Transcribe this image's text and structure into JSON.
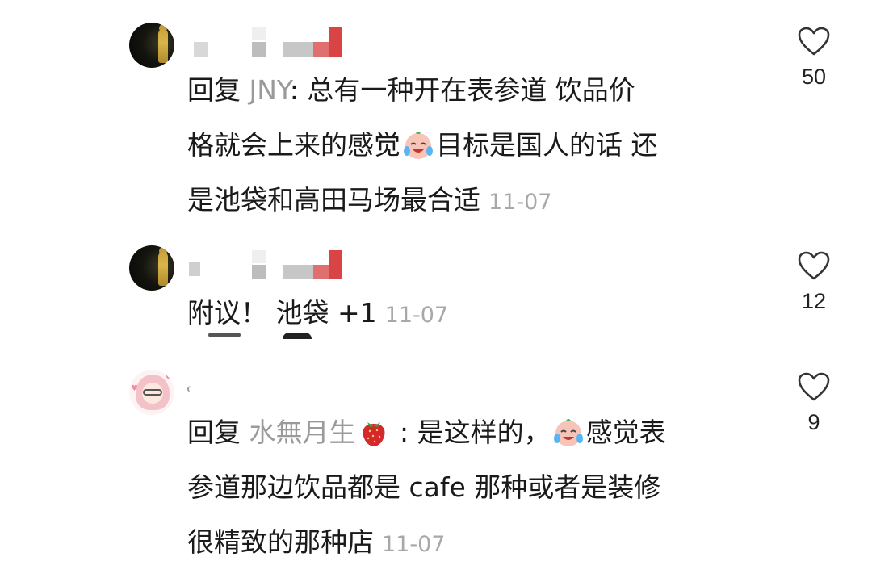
{
  "comments": [
    {
      "reply_prefix": "回复",
      "reply_to": "JNY",
      "separator": ": ",
      "body_line1": "总有一种开在表参道 饮品价",
      "body_line2a": "格就会上来的感觉",
      "body_line2b": "目标是国人的话 还",
      "body_line3": "是池袋和高田马场最合适",
      "time": "11-07",
      "likes": "50",
      "emoji": "crying-laughing-face-icon"
    },
    {
      "body": "附议！ 池袋 +1",
      "time": "11-07",
      "likes": "12"
    },
    {
      "reply_prefix": "回复",
      "reply_to": "水無月生",
      "separator": " : ",
      "body_line1a": "是这样的，",
      "body_line1b": "感觉表",
      "body_line2": "参道那边饮品都是 cafe 那种或者是装修",
      "body_line3": "很精致的那种店",
      "time": "11-07",
      "likes": "9",
      "emoji_name": "strawberry-icon",
      "emoji_body": "crying-laughing-face-icon"
    }
  ],
  "colors": {
    "text": "#1a1a1a",
    "username": "#9a9a9a",
    "timestamp": "#a8a8a8",
    "like_outline": "#333333"
  }
}
